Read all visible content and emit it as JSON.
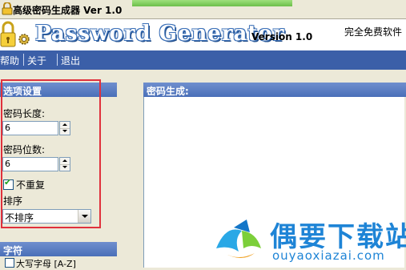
{
  "window": {
    "title": "高级密码生成器 Ver 1.0"
  },
  "banner": {
    "logo": "Password Generator",
    "version": "Version 1.0",
    "tagline": "完全免费软件"
  },
  "menu": {
    "items": [
      {
        "label": "帮助"
      },
      {
        "label": "关于"
      },
      {
        "label": "退出"
      }
    ]
  },
  "options_panel": {
    "header": "选项设置",
    "length_label": "密码长度:",
    "length_value": "6",
    "count_label": "密码位数:",
    "count_value": "6",
    "no_repeat_label": "不重复",
    "no_repeat_checked": true,
    "sort_label": "排序",
    "sort_selected": "不排序"
  },
  "characters_panel": {
    "header": "字符",
    "first_option": "大写字母 [A-Z]"
  },
  "generate_panel": {
    "header": "密码生成:"
  },
  "watermark": {
    "text": "偶要下载站",
    "url": "ouyaoxiazai.com"
  },
  "colors": {
    "menu_bg": "#3b5fa8",
    "panel_header": "#4a6fb8",
    "highlight_border": "#e0313c",
    "watermark_blue": "#1e84d6"
  }
}
